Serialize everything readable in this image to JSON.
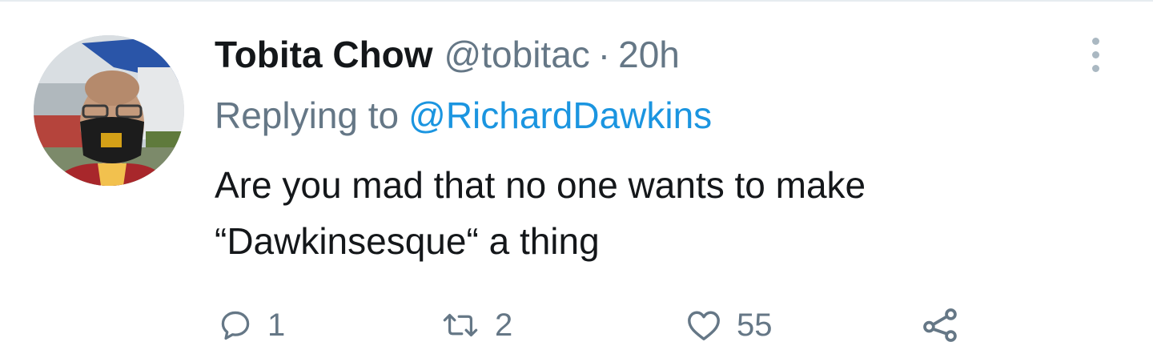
{
  "tweet": {
    "author": {
      "display_name": "Tobita Chow",
      "handle": "@tobitac",
      "avatar": "profile-photo-masked-man"
    },
    "separator": "·",
    "time": "20h",
    "reply_prefix": "Replying to",
    "reply_to": "@RichardDawkins",
    "text_lines": [
      "Are you mad that no one wants to make",
      "“Dawkinsesque“ a thing"
    ],
    "actions": {
      "reply": {
        "icon": "reply-icon",
        "count": "1"
      },
      "retweet": {
        "icon": "retweet-icon",
        "count": "2"
      },
      "like": {
        "icon": "heart-icon",
        "count": "55"
      },
      "share": {
        "icon": "share-icon"
      }
    },
    "more_icon": "more-vertical-icon"
  },
  "colors": {
    "primary_text": "#14171a",
    "secondary_text": "#657786",
    "link": "#1b95e0",
    "icon": "#657786",
    "divider": "#e6ecf0"
  }
}
